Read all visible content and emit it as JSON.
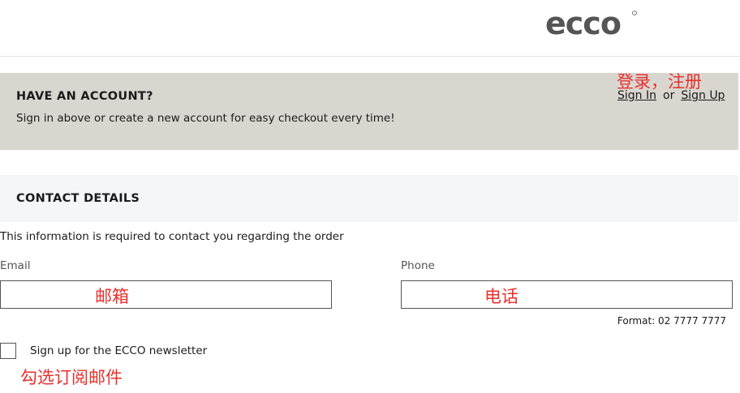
{
  "header": {
    "logo_text": "ecco"
  },
  "account": {
    "title": "HAVE AN ACCOUNT?",
    "description": "Sign in above or create a new account for easy checkout every time!",
    "annotation": "登录，注册",
    "sign_in_label": "Sign In",
    "or_label": "or",
    "sign_up_label": "Sign Up"
  },
  "contact": {
    "title": "CONTACT DETAILS",
    "info": "This information is required to contact you regarding the order",
    "email_label": "Email",
    "email_annotation": "邮箱",
    "phone_label": "Phone",
    "phone_annotation": "电话",
    "phone_format": "Format: 02 7777 7777",
    "newsletter_label": "Sign up for the ECCO newsletter",
    "newsletter_annotation": "勾选订阅邮件"
  },
  "colors": {
    "annotation": "#e8302c",
    "account_bg": "#d9d6d0",
    "contact_bg": "#f5f6f8",
    "logo": "#555555"
  }
}
